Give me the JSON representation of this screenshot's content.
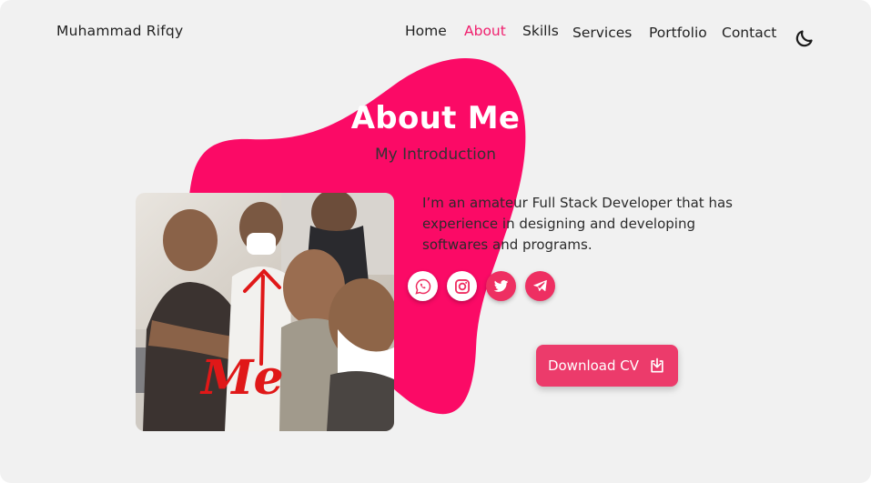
{
  "brand": {
    "name": "Muhammad Rifqy"
  },
  "nav": {
    "items": [
      {
        "label": "Home"
      },
      {
        "label": "About"
      },
      {
        "label": "Skills"
      },
      {
        "label": "Services"
      },
      {
        "label": "Portfolio"
      },
      {
        "label": "Contact"
      }
    ],
    "active": "About",
    "theme_icon": "moon-icon"
  },
  "about": {
    "title": "About Me",
    "subtitle": "My Introduction",
    "description": "I’m an amateur Full Stack Developer that has experience in designing and developing softwares and programs.",
    "photo_annotation": "Me"
  },
  "socials": [
    {
      "icon": "whatsapp-icon"
    },
    {
      "icon": "instagram-icon"
    },
    {
      "icon": "twitter-icon"
    },
    {
      "icon": "telegram-icon"
    }
  ],
  "download": {
    "label": "Download CV",
    "icon": "download-icon"
  },
  "colors": {
    "accent": "#f0206e",
    "blob": "#fb0a66",
    "button": "#ec3b6b",
    "background": "#f1f1f1"
  }
}
